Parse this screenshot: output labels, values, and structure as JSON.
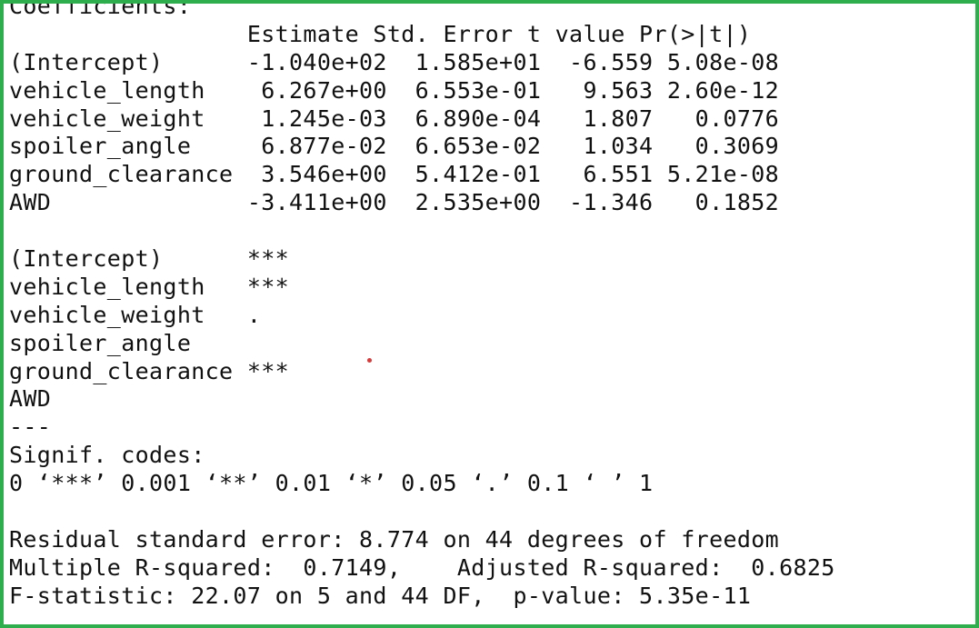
{
  "console": {
    "lines": [
      "Coefficients:",
      "                 Estimate Std. Error t value Pr(>|t|)",
      "(Intercept)      -1.040e+02  1.585e+01  -6.559 5.08e-08",
      "vehicle_length    6.267e+00  6.553e-01   9.563 2.60e-12",
      "vehicle_weight    1.245e-03  6.890e-04   1.807   0.0776",
      "spoiler_angle     6.877e-02  6.653e-02   1.034   0.3069",
      "ground_clearance  3.546e+00  5.412e-01   6.551 5.21e-08",
      "AWD              -3.411e+00  2.535e+00  -1.346   0.1852",
      "",
      "(Intercept)      ***",
      "vehicle_length   ***",
      "vehicle_weight   .",
      "spoiler_angle",
      "ground_clearance ***",
      "AWD",
      "---",
      "Signif. codes:",
      "0 ‘***’ 0.001 ‘**’ 0.01 ‘*’ 0.05 ‘.’ 0.1 ‘ ’ 1",
      "",
      "Residual standard error: 8.774 on 44 degrees of freedom",
      "Multiple R-squared:  0.7149,\tAdjusted R-squared:  0.6825",
      "F-statistic: 22.07 on 5 and 44 DF,  p-value: 5.35e-11"
    ]
  },
  "colors": {
    "border": "#2fae4e",
    "text": "#111111",
    "marker": "#d63a3a"
  }
}
